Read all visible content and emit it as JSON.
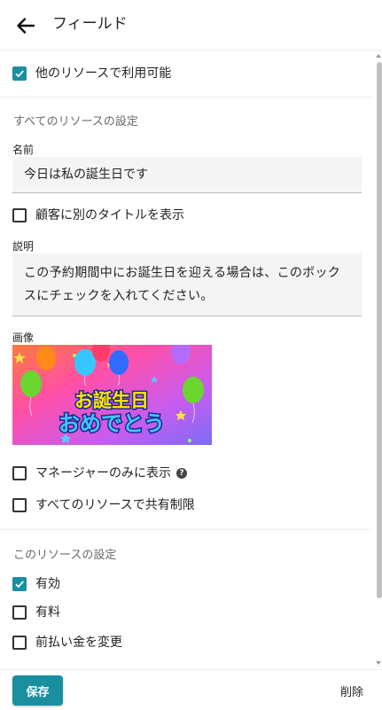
{
  "header": {
    "title": "フィールド",
    "back_icon": "arrow-left-icon"
  },
  "available_other_resources": {
    "label": "他のリソースで利用可能",
    "checked": true
  },
  "all_resources_section": {
    "title": "すべてのリソースの設定",
    "name": {
      "label": "名前",
      "value": "今日は私の誕生日です"
    },
    "customer_title": {
      "label": "顧客に別のタイトルを表示",
      "checked": false
    },
    "description": {
      "label": "説明",
      "value": "この予約期間中にお誕生日を迎える場合は、このボックスにチェックを入れてください。"
    },
    "image": {
      "label": "画像",
      "line1": "お誕生日",
      "line2": "おめでとう"
    },
    "manager_only": {
      "label": "マネージャーのみに表示",
      "checked": false,
      "icon": "question-circle-icon"
    },
    "shared_limit": {
      "label": "すべてのリソースで共有制限",
      "checked": false
    }
  },
  "this_resource_section": {
    "title": "このリソースの設定",
    "enabled": {
      "label": "有効",
      "checked": true
    },
    "paid": {
      "label": "有料",
      "checked": false
    },
    "change_deposit": {
      "label": "前払い金を変更",
      "checked": false
    }
  },
  "footer": {
    "save_label": "保存",
    "delete_label": "削除"
  },
  "colors": {
    "accent": "#1a8fa0"
  }
}
